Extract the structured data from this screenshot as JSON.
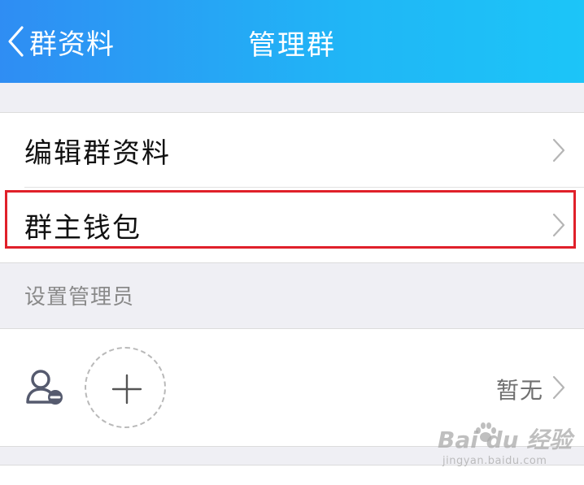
{
  "navbar": {
    "back_label": "群资料",
    "title": "管理群",
    "gradient_start": "#2f8df3",
    "gradient_end": "#1cc5f8"
  },
  "menu": {
    "items": [
      {
        "label": "编辑群资料",
        "icon": "chevron-right-icon"
      },
      {
        "label": "群主钱包",
        "icon": "chevron-right-icon",
        "highlighted": true
      }
    ],
    "highlight_color": "#e0202a"
  },
  "admins": {
    "section_header": "设置管理员",
    "value": "暂无",
    "admin_icon": "admin-user-icon",
    "add_icon": "plus-icon"
  },
  "watermark": {
    "main": "Bai du 经验",
    "sub": "jingyan.baidu.com"
  }
}
